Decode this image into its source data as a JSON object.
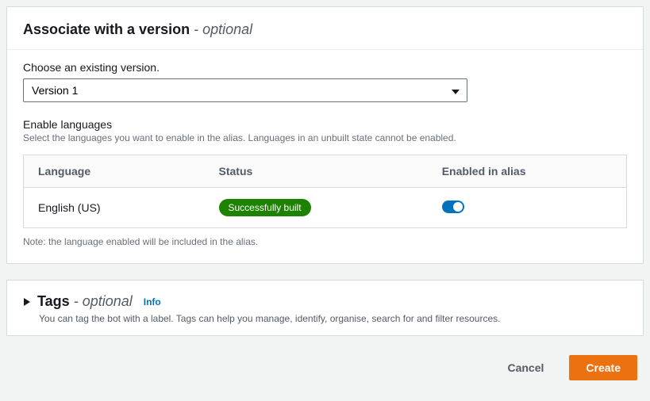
{
  "associate": {
    "title": "Associate with a version",
    "optional": "- optional",
    "choose_label": "Choose an existing version.",
    "selected_version": "Version 1",
    "enable_heading": "Enable languages",
    "enable_help": "Select the languages you want to enable in the alias. Languages in an unbuilt state cannot be enabled.",
    "table": {
      "col_language": "Language",
      "col_status": "Status",
      "col_enabled": "Enabled in alias",
      "rows": [
        {
          "language": "English (US)",
          "status": "Successfully built",
          "enabled": true
        }
      ]
    },
    "note": "Note: the language enabled will be included in the alias."
  },
  "tags": {
    "title": "Tags",
    "optional": "- optional",
    "info": "Info",
    "description": "You can tag the bot with a label. Tags can help you manage, identify, organise, search for and filter resources."
  },
  "footer": {
    "cancel": "Cancel",
    "create": "Create"
  }
}
